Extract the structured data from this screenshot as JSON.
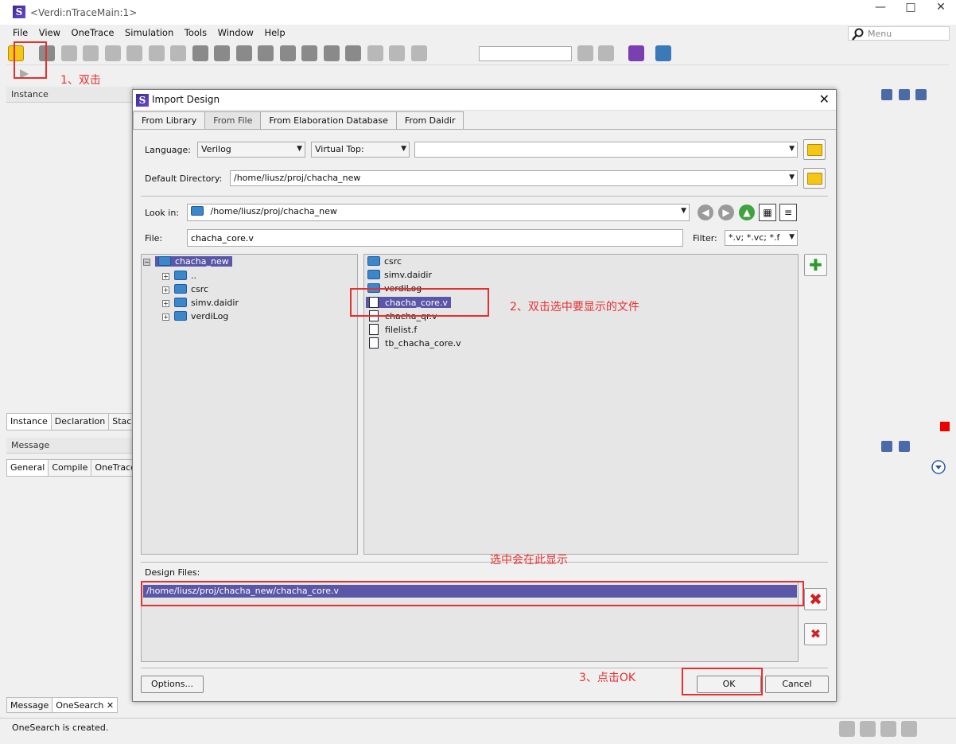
{
  "window": {
    "title": "<Verdi:nTraceMain:1>",
    "logo": "S",
    "controls": [
      "—",
      "□",
      "✕"
    ],
    "menu": [
      "File",
      "View",
      "OneTrace",
      "Simulation",
      "Tools",
      "Window",
      "Help"
    ],
    "menu_search_placeholder": "Menu"
  },
  "panels": {
    "instance_title": "Instance",
    "instance_tabs": [
      "Instance",
      "Declaration",
      "Stack"
    ],
    "message_title": "Message",
    "message_tabs": [
      "General",
      "Compile",
      "OneTrace"
    ],
    "bottom_tabs": [
      "Message",
      "OneSearch ✕"
    ],
    "status_text": "OneSearch is created."
  },
  "dialog": {
    "title": "Import Design",
    "tabs": [
      "From Library",
      "From File",
      "From Elaboration Database",
      "From Daidir"
    ],
    "active_tab": "From File",
    "language_label": "Language:",
    "language_value": "Verilog",
    "virtual_top_label": "Virtual Top:",
    "virtual_top_value": "",
    "default_directory_label": "Default Directory:",
    "default_directory_value": "/home/liusz/proj/chacha_new",
    "look_in_label": "Look in:",
    "look_in_value": "/home/liusz/proj/chacha_new",
    "file_label": "File:",
    "file_value": "chacha_core.v",
    "filter_label": "Filter:",
    "filter_value": "*.v; *.vc; *.f",
    "tree": {
      "root": "chacha_new",
      "children": [
        "..",
        "csrc",
        "simv.daidir",
        "verdiLog"
      ]
    },
    "files": [
      {
        "name": "csrc",
        "kind": "folder",
        "selected": false
      },
      {
        "name": "simv.daidir",
        "kind": "folder",
        "selected": false
      },
      {
        "name": "verdiLog",
        "kind": "folder",
        "selected": false
      },
      {
        "name": "chacha_core.v",
        "kind": "file",
        "selected": true
      },
      {
        "name": "chacha_qr.v",
        "kind": "file",
        "selected": false
      },
      {
        "name": "filelist.f",
        "kind": "file",
        "selected": false
      },
      {
        "name": "tb_chacha_core.v",
        "kind": "file",
        "selected": false
      }
    ],
    "design_files_label": "Design Files:",
    "design_files": [
      "/home/liusz/proj/chacha_new/chacha_core.v"
    ],
    "options_button": "Options...",
    "ok_button": "OK",
    "cancel_button": "Cancel",
    "close_glyph": "✕"
  },
  "annotations": {
    "step1": "1、双击",
    "step2": "2、双击选中要显示的文件",
    "step_show": "选中会在此显示",
    "step3": "3、点击OK"
  },
  "colors": {
    "selection": "#5a56a8",
    "annotation": "#e53030",
    "folder": "#f5c518",
    "accent_green": "#3fa33f"
  }
}
